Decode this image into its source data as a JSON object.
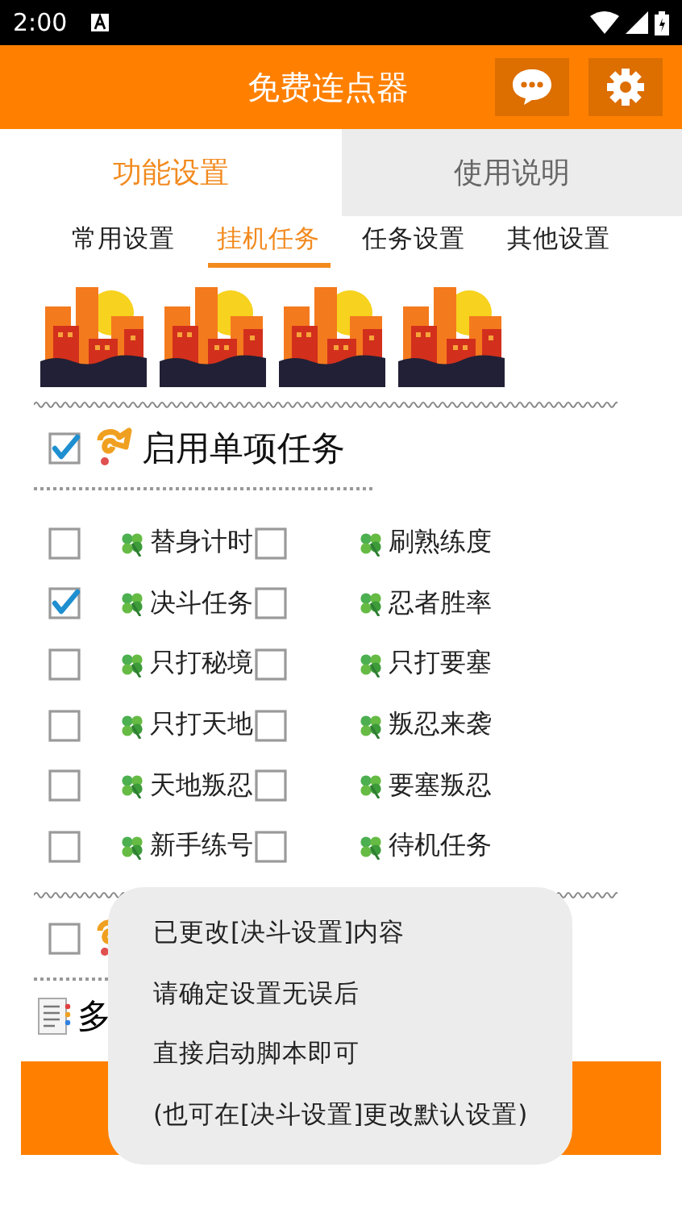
{
  "status_bar": {
    "time": "2:00"
  },
  "header": {
    "title": "免费连点器"
  },
  "main_tabs": [
    {
      "label": "功能设置",
      "selected": true
    },
    {
      "label": "使用说明",
      "selected": false
    }
  ],
  "sub_tabs": [
    {
      "label": "常用设置",
      "selected": false
    },
    {
      "label": "挂机任务",
      "selected": true
    },
    {
      "label": "任务设置",
      "selected": false
    },
    {
      "label": "其他设置",
      "selected": false
    }
  ],
  "single_task": {
    "label": "启用单项任务",
    "checked": true
  },
  "tasks": [
    {
      "label": "替身计时",
      "checked": false
    },
    {
      "label": "刷熟练度",
      "checked": false
    },
    {
      "label": "决斗任务",
      "checked": true
    },
    {
      "label": "忍者胜率",
      "checked": false
    },
    {
      "label": "只打秘境",
      "checked": false
    },
    {
      "label": "只打要塞",
      "checked": false
    },
    {
      "label": "只打天地",
      "checked": false
    },
    {
      "label": "叛忍来袭",
      "checked": false
    },
    {
      "label": "天地叛忍",
      "checked": false
    },
    {
      "label": "要塞叛忍",
      "checked": false
    },
    {
      "label": "新手练号",
      "checked": false
    },
    {
      "label": "待机任务",
      "checked": false
    }
  ],
  "multi_task": {
    "checked": false
  },
  "order_section": {
    "label": "多"
  },
  "toast": {
    "lines": [
      "已更改[决斗设置]内容",
      "请确定设置无误后",
      "直接启动脚本即可",
      "(也可在[决斗设置]更改默认设置)"
    ]
  }
}
